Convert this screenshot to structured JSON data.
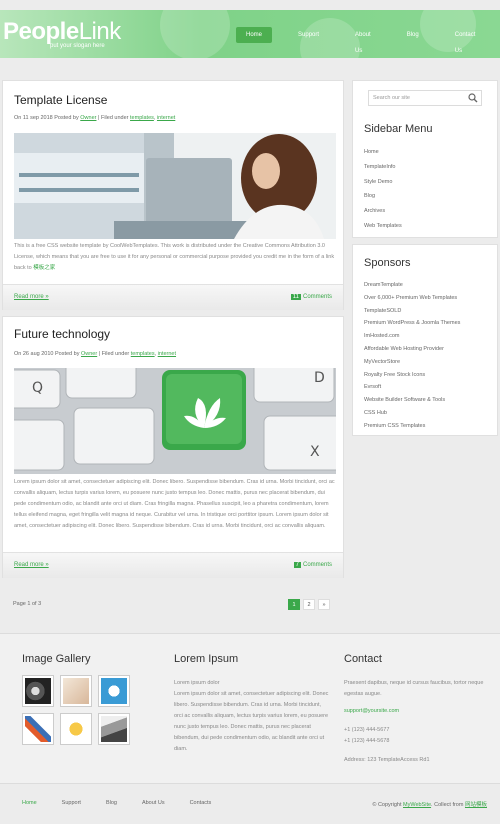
{
  "site": {
    "logo_bold": "People",
    "logo_thin": "Link",
    "slogan": "put your slogan here"
  },
  "nav": [
    "Home",
    "Support",
    "About Us",
    "Blog",
    "Contact Us"
  ],
  "posts": [
    {
      "title": "Template License",
      "meta_prefix": "On 11 sep 2018 Posted by",
      "author": "Owner",
      "filed_label": "Filed under",
      "tag1": "templates",
      "tag2": "internet",
      "body": "This is a free CSS website template by CoolWebTemplates. This work is distributed under the Creative Commons Attribution 3.0 License, which means that you are free to use it for any personal or commercial purpose provided you credit me in the form of a link back to",
      "body_link": "模板之家",
      "read_more": "Read more »",
      "comment_count": "11",
      "comments_label": "Comments"
    },
    {
      "title": "Future technology",
      "meta_prefix": "On 26 aug 2010 Posted by",
      "author": "Owner",
      "filed_label": "Filed under",
      "tag1": "templates",
      "tag2": "internet",
      "body": "Lorem ipsum dolor sit amet, consectetuer adipiscing elit. Donec libero. Suspendisse bibendum. Cras id urna. Morbi tincidunt, orci ac convallis aliquam, lectus turpis varius lorem, eu posuere nunc justo tempus leo. Donec mattis, purus nec placerat bibendum, dui pede condimentum odio, ac blandit ante orci ut diam. Cras fringilla magna. Phasellus suscipit, leo a pharetra condimentum, lorem tellus eleifend magna, eget fringilla velit magna id neque. Curabitur vel urna. In tristique orci porttitor ipsum. Lorem ipsum dolor sit amet, consectetuer adipiscing elit. Donec libero. Suspendisse bibendum. Cras id urna. Morbi tincidunt, orci ac convallis aliquam.",
      "read_more": "Read more »",
      "comment_count": "7",
      "comments_label": "Comments"
    }
  ],
  "search": {
    "placeholder": "Search our site"
  },
  "sidebar_menu": {
    "title": "Sidebar Menu",
    "items": [
      "Home",
      "TemplateInfo",
      "Style Demo",
      "Blog",
      "Archives",
      "Web Templates"
    ]
  },
  "sponsors": {
    "title": "Sponsors",
    "items": [
      {
        "name": "DreamTemplate",
        "desc": "Over 6,000+ Premium Web Templates"
      },
      {
        "name": "TemplateSOLD",
        "desc": "Premium WordPress & Joomla Themes"
      },
      {
        "name": "ImHosted.com",
        "desc": "Affordable Web Hosting Provider"
      },
      {
        "name": "MyVectorStore",
        "desc": "Royalty Free Stock Icons"
      },
      {
        "name": "Evrsoft",
        "desc": "Website Builder Software & Tools"
      },
      {
        "name": "CSS Hub",
        "desc": "Premium CSS Templates"
      }
    ]
  },
  "pagination": {
    "info": "Page 1 of 3",
    "pages": [
      "1",
      "2",
      "»"
    ]
  },
  "gallery": {
    "title": "Image Gallery"
  },
  "lorem": {
    "title": "Lorem Ipsum",
    "intro": "Lorem ipsum dolor",
    "text": "Lorem ipsum dolor sit amet, consectetuer adipiscing elit. Donec libero. Suspendisse bibendum. Cras id urna. Morbi tincidunt, orci ac convallis aliquam, lectus turpis varius lorem, eu posuere nunc justo tempus leo. Donec mattis, purus nec placerat bibendum, dui pede condimentum odio, ac blandit ante orci ut diam."
  },
  "contact": {
    "title": "Contact",
    "text": "Praesent dapibus, neque id cursus faucibus, tortor neque egestas augue.",
    "email": "support@yoursite.com",
    "phone1": "+1 (123) 444-5677",
    "phone2": "+1 (123) 444-5678",
    "address": "Address: 123 TemplateAccess Rd1"
  },
  "footer": {
    "links": [
      "Home",
      "Support",
      "Blog",
      "About Us",
      "Contacts"
    ],
    "copy_prefix": "© Copyright",
    "copy_link1": "MyWebSite",
    "copy_mid": ". Collect from",
    "copy_link2": "网站模板"
  },
  "colors": {
    "accent": "#3aa84a",
    "header": "#7fd288"
  }
}
